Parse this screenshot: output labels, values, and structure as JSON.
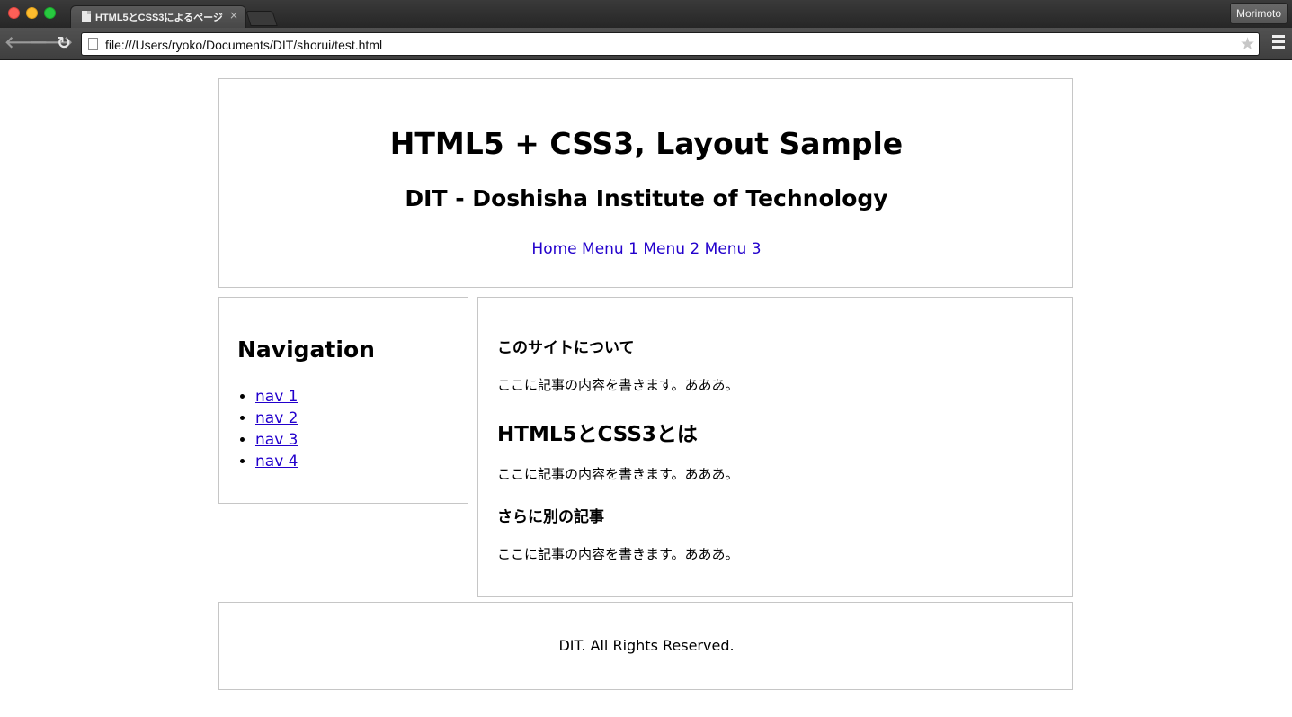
{
  "browser": {
    "tab_title": "HTML5とCSS3によるページ",
    "tab_close": "×",
    "profile_name": "Morimoto",
    "url": "file:///Users/ryoko/Documents/DIT/shorui/test.html",
    "back_icon": "🡐",
    "forward_icon": "🡒",
    "reload_icon": "↻",
    "star_icon": "★"
  },
  "header": {
    "title": "HTML5 + CSS3, Layout Sample",
    "subtitle": "DIT - Doshisha Institute of Technology",
    "menu": [
      "Home",
      "Menu 1",
      "Menu 2",
      "Menu 3"
    ]
  },
  "sidebar": {
    "heading": "Navigation",
    "items": [
      "nav 1",
      "nav 2",
      "nav 3",
      "nav 4"
    ]
  },
  "main": {
    "articles": [
      {
        "heading": "このサイトについて",
        "body": "ここに記事の内容を書きます。あああ。"
      },
      {
        "heading": "HTML5とCSS3とは",
        "body": "ここに記事の内容を書きます。あああ。"
      },
      {
        "heading": "さらに別の記事",
        "body": "ここに記事の内容を書きます。あああ。"
      }
    ]
  },
  "footer": {
    "text": "DIT. All Rights Reserved."
  },
  "colors": {
    "link": "#2200cc",
    "border": "#c6c6c6"
  }
}
